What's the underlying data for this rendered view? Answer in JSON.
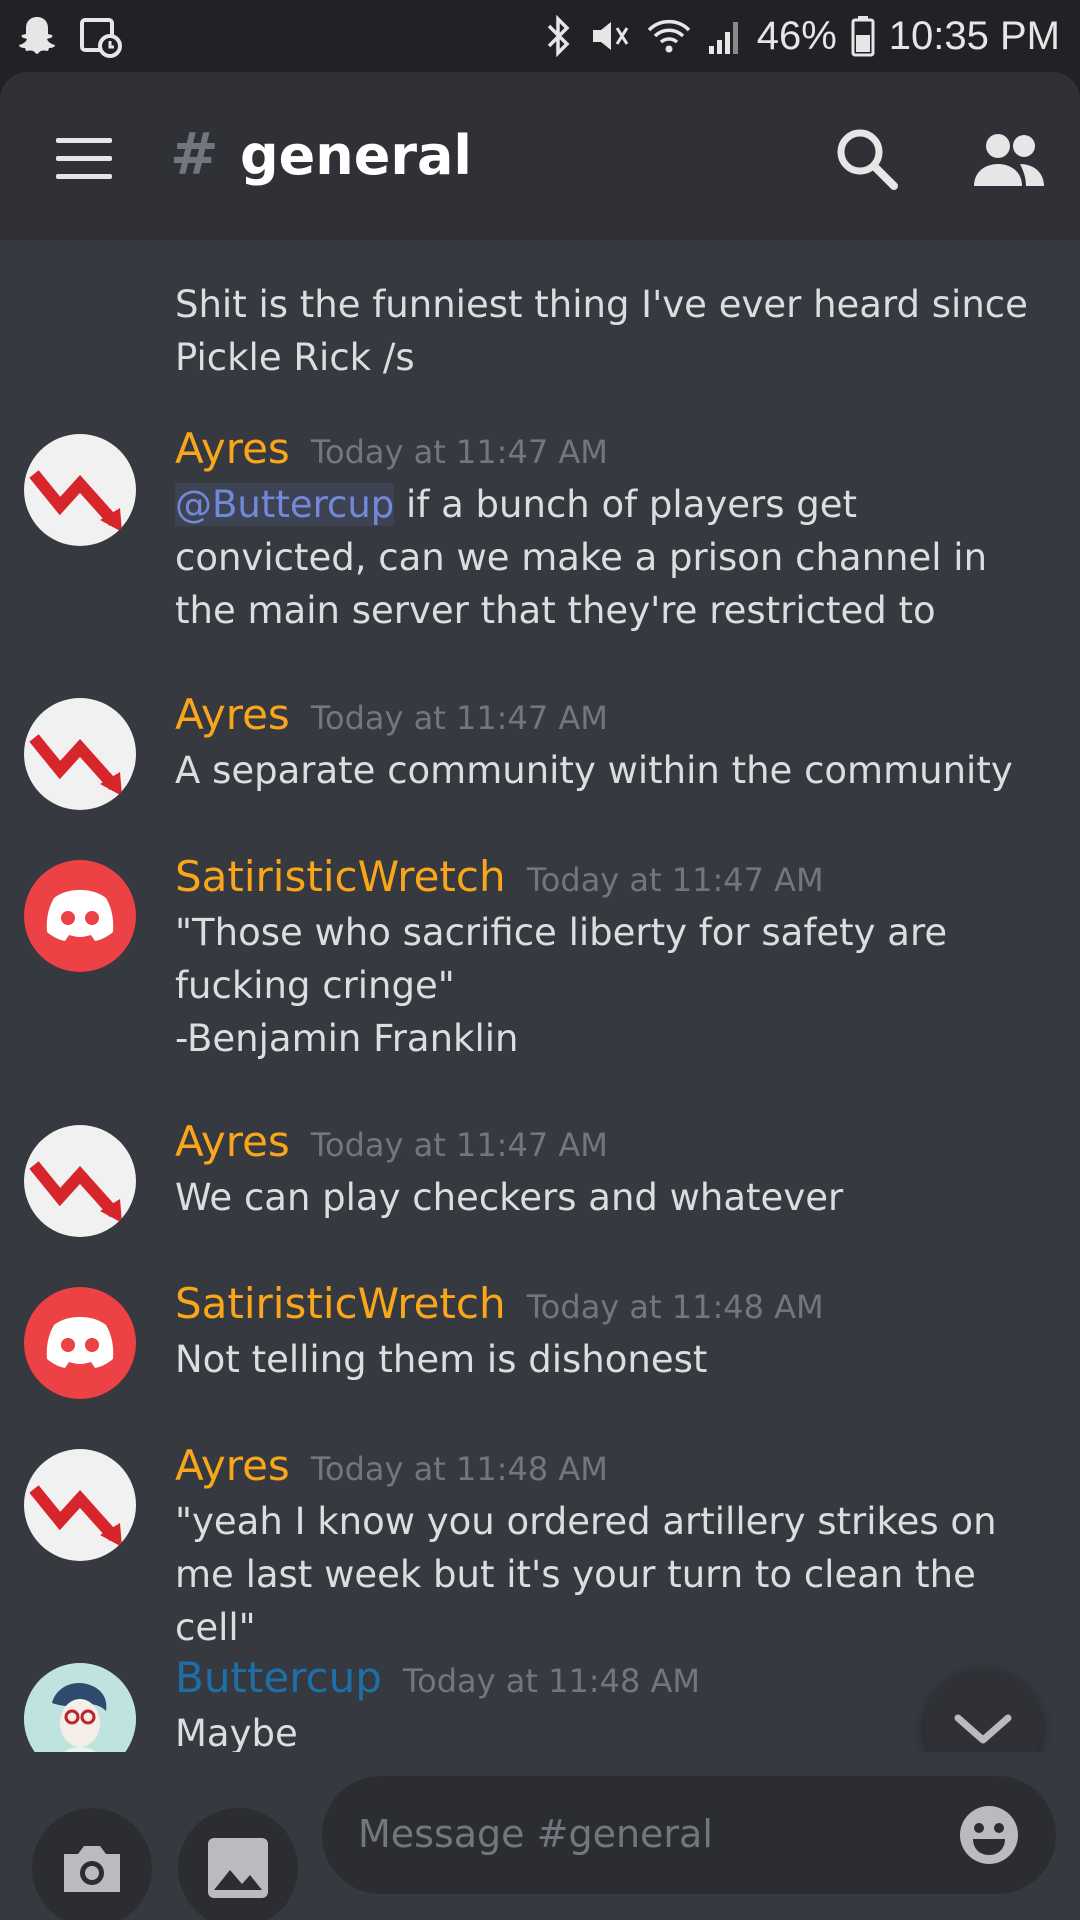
{
  "status_bar": {
    "battery": "46%",
    "time": "10:35 PM"
  },
  "header": {
    "hash": "#",
    "channel": "general"
  },
  "messages": [
    {
      "text": "Shit is the funniest thing I've ever heard since Pickle Rick /s"
    },
    {
      "author": "Ayres",
      "time": "Today at 11:47 AM",
      "mention": "@Buttercup",
      "text": " if a bunch of players get convicted, can we make a prison channel in the main server that they're restricted to"
    },
    {
      "author": "Ayres",
      "time": "Today at 11:47 AM",
      "text": "A separate community within the community"
    },
    {
      "author": "SatiristicWretch",
      "time": "Today at 11:47 AM",
      "text": "\"Those who sacrifice liberty for safety are fucking cringe\"\n-Benjamin Franklin"
    },
    {
      "author": "Ayres",
      "time": "Today at 11:47 AM",
      "text": "We can play checkers and whatever"
    },
    {
      "author": "SatiristicWretch",
      "time": "Today at 11:48 AM",
      "text": "Not telling them is dishonest"
    },
    {
      "author": "Ayres",
      "time": "Today at 11:48 AM",
      "text": "\"yeah I know you ordered artillery strikes on me last week but it's your turn to clean the cell\""
    },
    {
      "author": "Buttercup",
      "time": "Today at 11:48 AM",
      "text": "Maybe"
    }
  ],
  "composer": {
    "placeholder": "Message #general"
  },
  "colors": {
    "background": "#36393f",
    "header": "#2f3136",
    "author_orange": "#faa61a",
    "author_blue": "#1e6fa8",
    "mention": "#7289da"
  }
}
